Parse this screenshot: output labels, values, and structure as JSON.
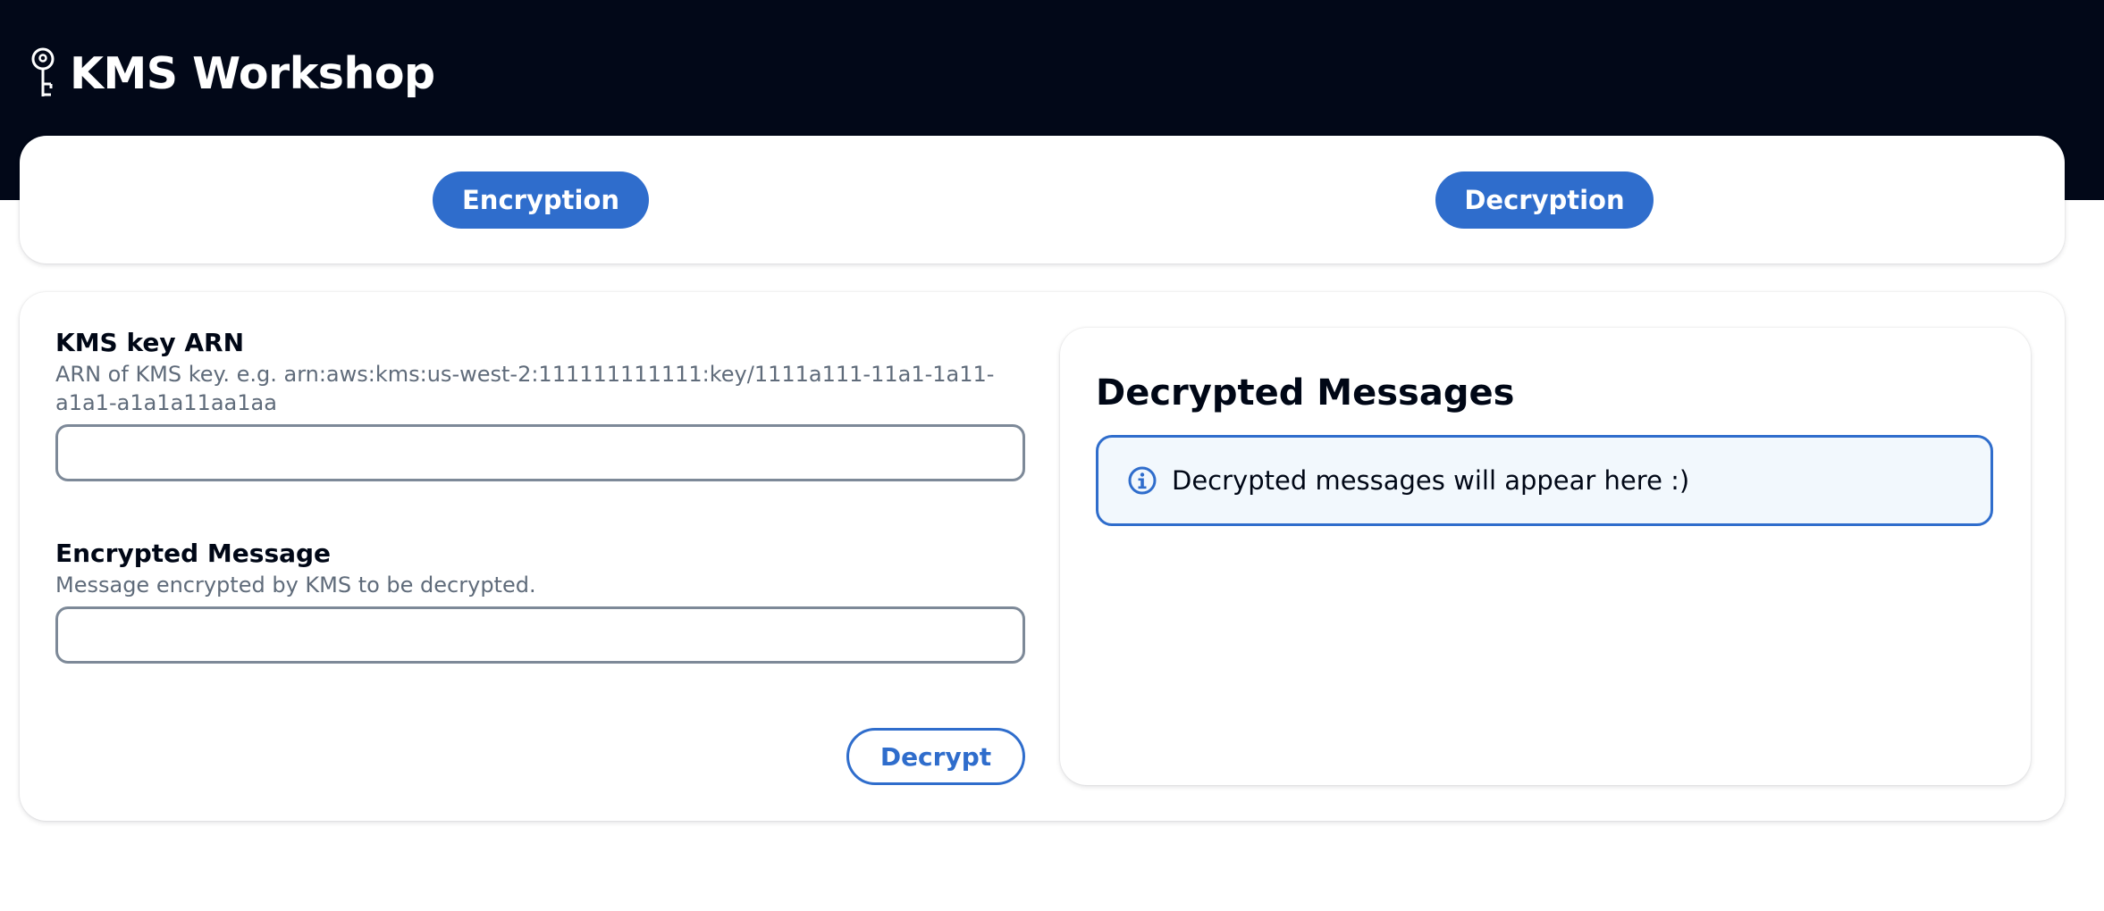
{
  "header": {
    "title": "KMS Workshop",
    "icon": "key-icon"
  },
  "nav": {
    "encryption_label": "Encryption",
    "decryption_label": "Decryption"
  },
  "form": {
    "arn_label": "KMS key ARN",
    "arn_description": "ARN of KMS key. e.g. arn:aws:kms:us-west-2:111111111111:key/1111a111-11a1-1a11-a1a1-a1a1a11aa1aa",
    "arn_value": "",
    "message_label": "Encrypted Message",
    "message_description": "Message encrypted by KMS to be decrypted.",
    "message_value": "",
    "decrypt_label": "Decrypt"
  },
  "messages": {
    "title": "Decrypted Messages",
    "alert_icon": "info-icon",
    "alert_text": "Decrypted messages will appear here :)"
  },
  "colors": {
    "header_bg": "#020818",
    "accent": "#2f6dcc",
    "alert_bg": "#f2f8fd"
  }
}
